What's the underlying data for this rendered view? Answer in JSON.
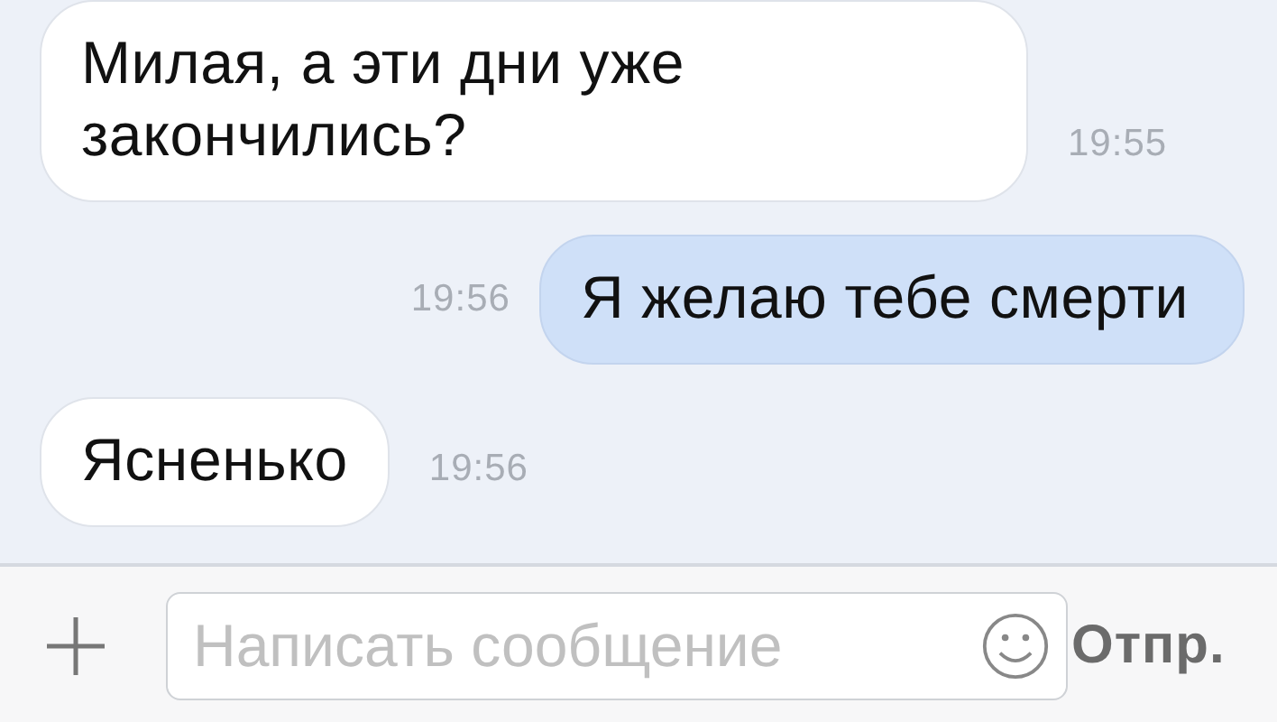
{
  "messages": [
    {
      "kind": "incoming",
      "text": "Милая, а эти дни уже закончились?",
      "time": "19:55"
    },
    {
      "kind": "outgoing",
      "text": "Я желаю тебе смерти",
      "time": "19:56"
    },
    {
      "kind": "incoming",
      "text": "Ясненько",
      "time": "19:56"
    }
  ],
  "composer": {
    "placeholder": "Написать сообщение",
    "send_label": "Отпр."
  }
}
